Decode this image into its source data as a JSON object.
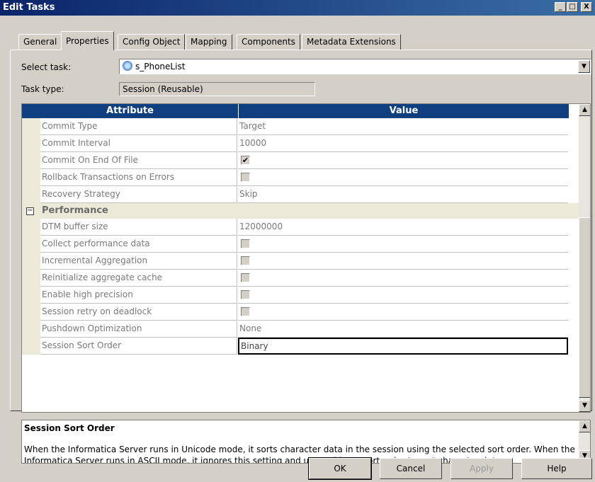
{
  "window": {
    "title": "Edit Tasks",
    "minimize": "_",
    "restore": "□",
    "close": "X"
  },
  "tabs": [
    {
      "label": "General"
    },
    {
      "label": "Properties"
    },
    {
      "label": "Config Object"
    },
    {
      "label": "Mapping"
    },
    {
      "label": "Components"
    },
    {
      "label": "Metadata Extensions"
    }
  ],
  "active_tab": "Properties",
  "select_task": {
    "label": "Select task:",
    "value": "s_PhoneList"
  },
  "task_type": {
    "label": "Task type:",
    "value": "Session (Reusable)"
  },
  "grid": {
    "header_attribute": "Attribute",
    "header_value": "Value",
    "rows": [
      {
        "attribute": "Commit Type",
        "value": "Target"
      },
      {
        "attribute": "Commit Interval",
        "value": "10000"
      },
      {
        "attribute": "Commit On End Of File",
        "checked": true
      },
      {
        "attribute": "Rollback Transactions on Errors",
        "checked": false
      },
      {
        "attribute": "Recovery Strategy",
        "value": "Skip"
      }
    ],
    "section": "Performance",
    "perf_rows": [
      {
        "attribute": "DTM buffer size",
        "value": "12000000"
      },
      {
        "attribute": "Collect performance data",
        "checked": false
      },
      {
        "attribute": "Incremental Aggregation",
        "checked": false
      },
      {
        "attribute": "Reinitialize aggregate cache",
        "checked": false
      },
      {
        "attribute": "Enable high precision",
        "checked": false
      },
      {
        "attribute": "Session retry on deadlock",
        "checked": false
      },
      {
        "attribute": "Pushdown Optimization",
        "value": "None"
      },
      {
        "attribute": "Session Sort Order",
        "value": "Binary"
      }
    ]
  },
  "description": {
    "title": "Session Sort Order",
    "body": "When the Informatica Server runs in Unicode mode, it sorts character data in the session using the selected sort order. When the Informatica Server runs in ASCII mode, it ignores this setting and uses a binary sort order to sort character data."
  },
  "buttons": {
    "ok": "OK",
    "cancel": "Cancel",
    "apply": "Apply",
    "help": "Help"
  },
  "icons": {
    "check_mark": "✔",
    "collapse": "−",
    "arrow_up": "▲",
    "arrow_down": "▼"
  }
}
